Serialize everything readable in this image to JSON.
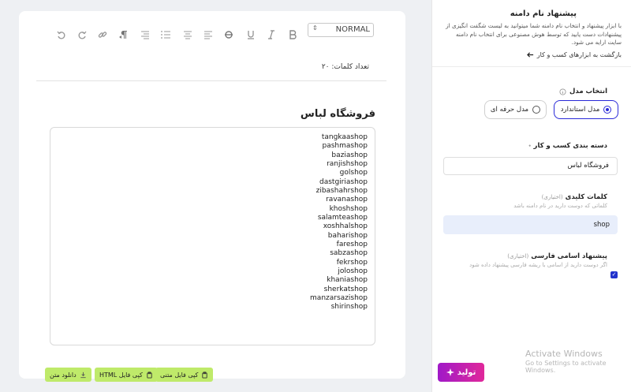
{
  "toolbar": {
    "format_value": "NORMAL",
    "icons": [
      "undo-icon",
      "redo-icon",
      "link-icon",
      "rtl-paragraph-icon",
      "align-right-icon",
      "ordered-list-icon",
      "align-center-icon",
      "align-left-icon",
      "strikethrough-icon",
      "underline-icon",
      "italic-icon",
      "bold-icon"
    ]
  },
  "editor": {
    "word_count": "تعداد کلمات: ۲۰",
    "title": "فروشگاه لباس",
    "names": [
      "tangkaashop",
      "pashmashop",
      "baziashop",
      "ranjishshop",
      "golshop",
      "dastgiriashop",
      "zibashahrshop",
      "ravanashop",
      "khoshshop",
      "salamteashop",
      "xoshhalshop",
      "baharishop",
      "fareshop",
      "sabzashop",
      "fekrshop",
      "joloshop",
      "khaniashop",
      "sherkatshop",
      "manzarsazishop",
      "shirinshop"
    ]
  },
  "buttons": {
    "copy_text": "کپی فایل متنی",
    "copy_html": "کپی فایل HTML",
    "download_text": "دانلود متن"
  },
  "panel": {
    "title": "پیشنهاد نام دامنه",
    "description": "با ابزار پیشنهاد و انتخاب نام دامنه شما میتوانید به لیست شگفت انگیزی از پیشنهادات دست یابید که توسط هوش مصنوعی برای انتخاب نام دامنه سایت ارایه می شود.",
    "back_link": "بازگشت به ابزارهای کسب و کار",
    "model_label": "انتخاب مدل",
    "model_standard": "مدل استاندارد",
    "model_pro": "مدل حرفه ای",
    "category_label": "دسته بندی کسب و کار",
    "category_value": "فروشگاه لباس",
    "keywords_label": "کلمات کلیدی",
    "optional": "(اختیاری)",
    "keywords_help": "کلماتی که دوست دارید در نام دامنه باشد",
    "keywords_value": "shop",
    "persian_label": "پیشنهاد اسامی فارسی",
    "persian_help": "اگر دوست دارید از اسامی با ریشه فارسی پیشنهاد داده شود",
    "generate": "تولید"
  },
  "watermark": {
    "line1": "Activate Windows",
    "line2": "Go to Settings to activate Windows."
  },
  "colors": {
    "accent_blue": "#2a2ad8",
    "green_button": "#bfea6a",
    "generate_gradient_start": "#a019c8",
    "generate_gradient_end": "#e0289a"
  }
}
